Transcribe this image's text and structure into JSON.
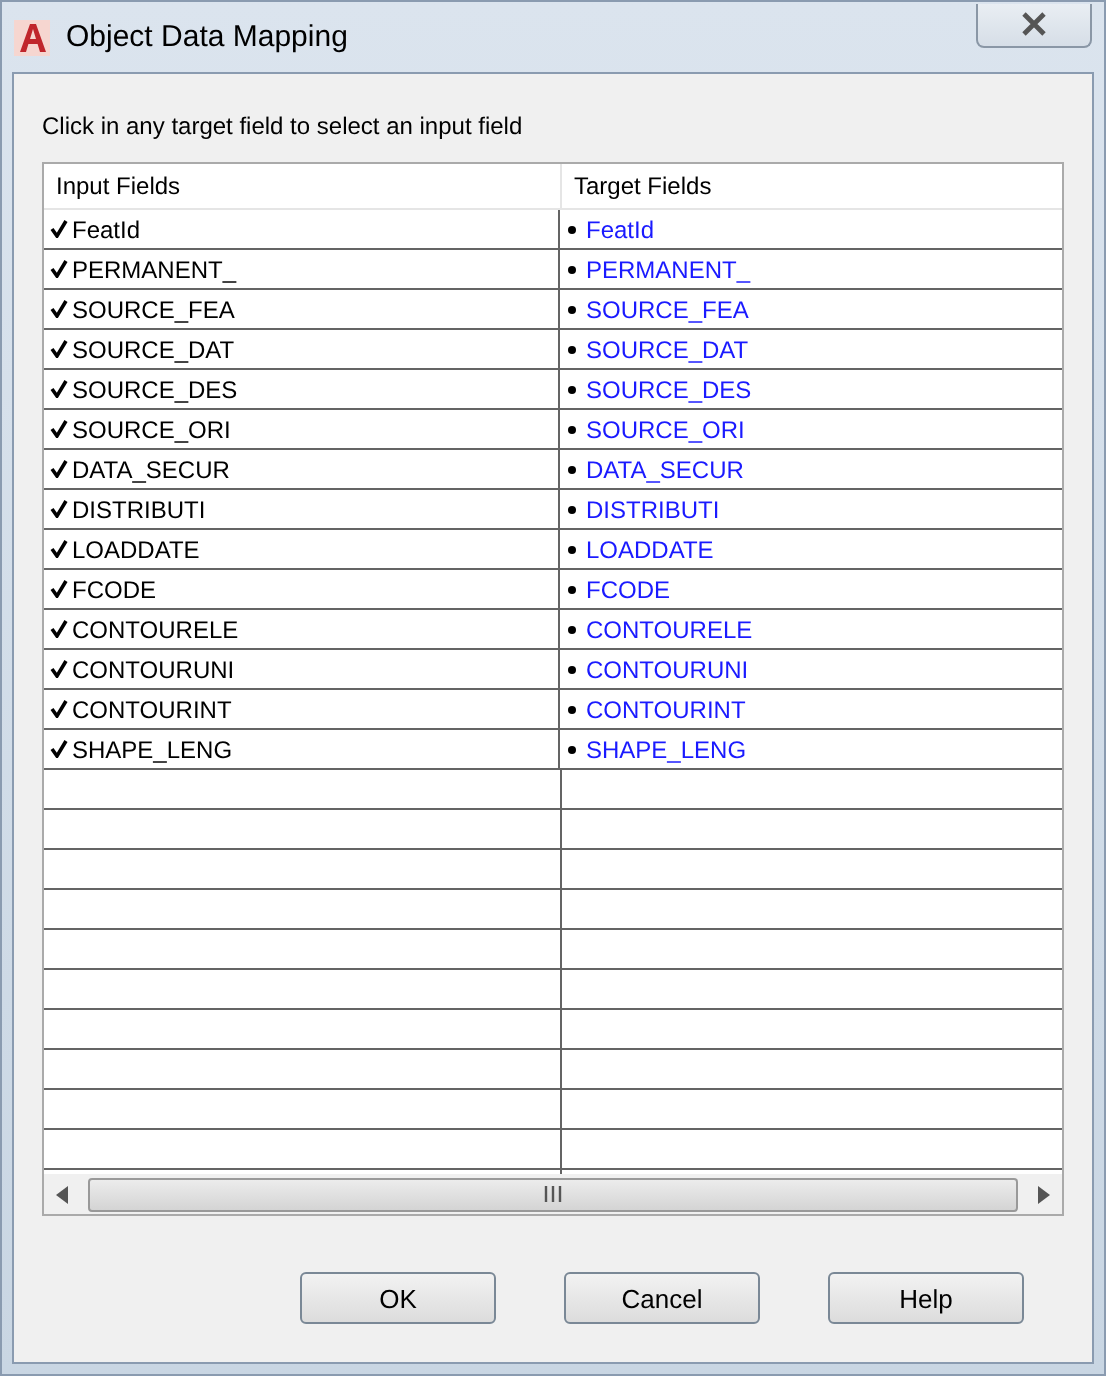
{
  "window": {
    "title": "Object Data Mapping"
  },
  "instruction": "Click in any target field to select an input field",
  "table": {
    "columns": [
      "Input Fields",
      "Target Fields"
    ],
    "rows": [
      {
        "input": "FeatId",
        "checked": true,
        "target": "FeatId"
      },
      {
        "input": "PERMANENT_",
        "checked": true,
        "target": "PERMANENT_"
      },
      {
        "input": "SOURCE_FEA",
        "checked": true,
        "target": "SOURCE_FEA"
      },
      {
        "input": "SOURCE_DAT",
        "checked": true,
        "target": "SOURCE_DAT"
      },
      {
        "input": "SOURCE_DES",
        "checked": true,
        "target": "SOURCE_DES"
      },
      {
        "input": "SOURCE_ORI",
        "checked": true,
        "target": "SOURCE_ORI"
      },
      {
        "input": "DATA_SECUR",
        "checked": true,
        "target": "DATA_SECUR"
      },
      {
        "input": "DISTRIBUTI",
        "checked": true,
        "target": "DISTRIBUTI"
      },
      {
        "input": "LOADDATE",
        "checked": true,
        "target": "LOADDATE"
      },
      {
        "input": "FCODE",
        "checked": true,
        "target": "FCODE"
      },
      {
        "input": "CONTOURELE",
        "checked": true,
        "target": "CONTOURELE"
      },
      {
        "input": "CONTOURUNI",
        "checked": true,
        "target": "CONTOURUNI"
      },
      {
        "input": "CONTOURINT",
        "checked": true,
        "target": "CONTOURINT"
      },
      {
        "input": "SHAPE_LENG",
        "checked": true,
        "target": "SHAPE_LENG"
      }
    ]
  },
  "buttons": [
    "OK",
    "Cancel",
    "Help"
  ]
}
